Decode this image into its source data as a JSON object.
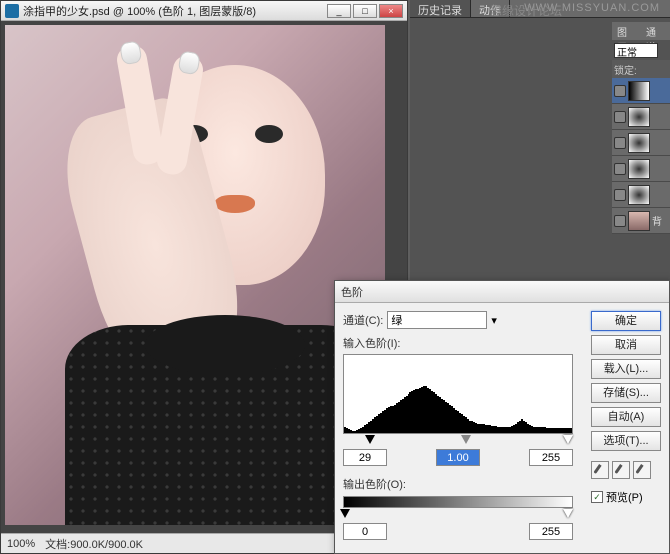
{
  "watermark_right": "WWW.MISSYUAN.COM",
  "watermark_center": "思缘设计论坛",
  "doc": {
    "title": "涂指甲的少女.psd @ 100% (色阶 1, 图层蒙版/8)",
    "zoom": "100%",
    "status": "文档:900.0K/900.0K"
  },
  "history_panel": {
    "tab_history": "历史记录",
    "tab_actions": "动作"
  },
  "layers_panel": {
    "tab_layers": "图层",
    "tab_channels": "通道",
    "blend": "正常",
    "lock": "锁定:",
    "bg_label": "背"
  },
  "levels": {
    "title": "色阶",
    "channel_label": "通道(C):",
    "channel_value": "绿",
    "input_label": "输入色阶(I):",
    "output_label": "输出色阶(O):",
    "in_black": "29",
    "in_gamma": "1.00",
    "in_white": "255",
    "out_black": "0",
    "out_white": "255",
    "btn_ok": "确定",
    "btn_cancel": "取消",
    "btn_load": "载入(L)...",
    "btn_save": "存储(S)...",
    "btn_auto": "自动(A)",
    "btn_options": "选项(T)...",
    "chk_preview": "预览(P)"
  },
  "chart_data": {
    "type": "bar",
    "title": "",
    "xlabel": "",
    "ylabel": "",
    "xlim": [
      0,
      255
    ],
    "ylim": [
      0,
      100
    ],
    "values": [
      8,
      6,
      5,
      4,
      3,
      3,
      4,
      5,
      6,
      8,
      10,
      12,
      14,
      16,
      18,
      20,
      22,
      24,
      26,
      28,
      30,
      32,
      33,
      34,
      35,
      36,
      38,
      40,
      42,
      44,
      46,
      48,
      50,
      52,
      54,
      55,
      56,
      57,
      58,
      59,
      60,
      60,
      58,
      56,
      54,
      52,
      50,
      48,
      46,
      44,
      42,
      40,
      38,
      36,
      34,
      32,
      30,
      28,
      26,
      24,
      22,
      20,
      18,
      16,
      15,
      14,
      13,
      12,
      12,
      11,
      11,
      10,
      10,
      10,
      9,
      9,
      9,
      8,
      8,
      8,
      8,
      8,
      8,
      8,
      9,
      10,
      12,
      14,
      16,
      18,
      16,
      14,
      12,
      10,
      9,
      8,
      8,
      8,
      8,
      8,
      8,
      8,
      7,
      7,
      7,
      7,
      7,
      7,
      7,
      7,
      7,
      7,
      7,
      6,
      6
    ]
  }
}
